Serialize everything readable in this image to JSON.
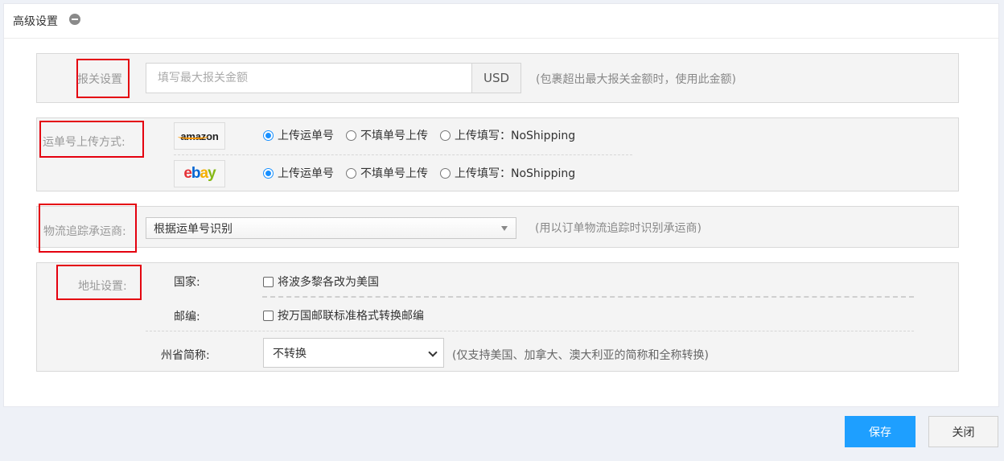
{
  "panel": {
    "title": "高级设置"
  },
  "customs": {
    "label": "报关设置",
    "input_placeholder": "填写最大报关金额",
    "input_value": "",
    "currency": "USD",
    "hint": "(包裹超出最大报关金额时，使用此金额)"
  },
  "tracking_upload": {
    "label": "运单号上传方式:",
    "platforms": [
      {
        "name": "amazon",
        "options": [
          "上传运单号",
          "不填单号上传",
          "上传填写：NoShipping"
        ],
        "selected": 0
      },
      {
        "name": "ebay",
        "options": [
          "上传运单号",
          "不填单号上传",
          "上传填写：NoShipping"
        ],
        "selected": 0
      }
    ]
  },
  "carrier": {
    "label": "物流追踪承运商:",
    "selected": "根据运单号识别",
    "hint": "(用以订单物流追踪时识别承运商)"
  },
  "address": {
    "label": "地址设置:",
    "country_label": "国家:",
    "country_option": "将波多黎各改为美国",
    "zip_label": "邮编:",
    "zip_option": "按万国邮联标准格式转换邮编",
    "state_label": "州省简称:",
    "state_selected": "不转换",
    "state_hint": "(仅支持美国、加拿大、澳大利亚的简称和全称转换)"
  },
  "footer": {
    "save": "保存",
    "close": "关闭"
  },
  "colors": {
    "primary": "#1e9fff",
    "annotation_red": "#e4000f",
    "radio_checked": "#1890ff"
  }
}
